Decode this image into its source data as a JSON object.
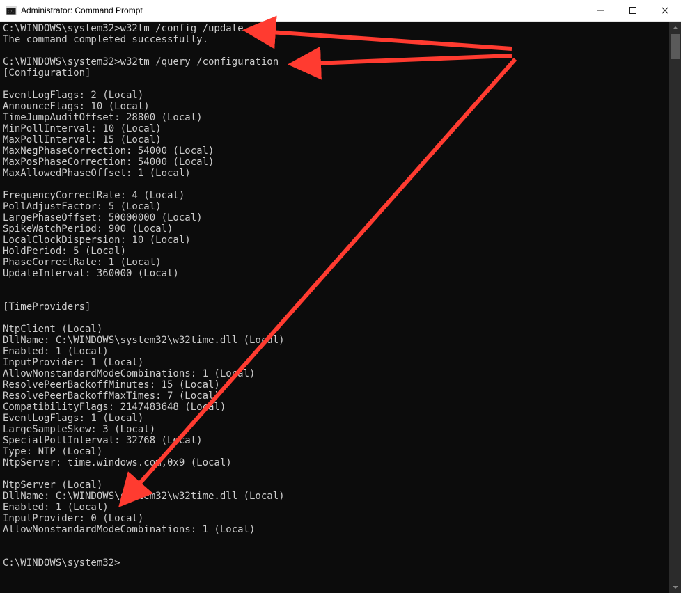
{
  "window": {
    "title": "Administrator: Command Prompt"
  },
  "terminal": {
    "prompt": "C:\\WINDOWS\\system32>",
    "cmd1": "w32tm /config /update",
    "cmd1_out": "The command completed successfully.",
    "cmd2": "w32tm /query /configuration",
    "configHeader": "[Configuration]",
    "config": [
      "EventLogFlags: 2 (Local)",
      "AnnounceFlags: 10 (Local)",
      "TimeJumpAuditOffset: 28800 (Local)",
      "MinPollInterval: 10 (Local)",
      "MaxPollInterval: 15 (Local)",
      "MaxNegPhaseCorrection: 54000 (Local)",
      "MaxPosPhaseCorrection: 54000 (Local)",
      "MaxAllowedPhaseOffset: 1 (Local)"
    ],
    "config2": [
      "FrequencyCorrectRate: 4 (Local)",
      "PollAdjustFactor: 5 (Local)",
      "LargePhaseOffset: 50000000 (Local)",
      "SpikeWatchPeriod: 900 (Local)",
      "LocalClockDispersion: 10 (Local)",
      "HoldPeriod: 5 (Local)",
      "PhaseCorrectRate: 1 (Local)",
      "UpdateInterval: 360000 (Local)"
    ],
    "providersHeader": "[TimeProviders]",
    "ntpClient": [
      "NtpClient (Local)",
      "DllName: C:\\WINDOWS\\system32\\w32time.dll (Local)",
      "Enabled: 1 (Local)",
      "InputProvider: 1 (Local)",
      "AllowNonstandardModeCombinations: 1 (Local)",
      "ResolvePeerBackoffMinutes: 15 (Local)",
      "ResolvePeerBackoffMaxTimes: 7 (Local)",
      "CompatibilityFlags: 2147483648 (Local)",
      "EventLogFlags: 1 (Local)",
      "LargeSampleSkew: 3 (Local)",
      "SpecialPollInterval: 32768 (Local)",
      "Type: NTP (Local)",
      "NtpServer: time.windows.com,0x9 (Local)"
    ],
    "ntpServer": [
      "NtpServer (Local)",
      "DllName: C:\\WINDOWS\\system32\\w32time.dll (Local)",
      "Enabled: 1 (Local)",
      "InputProvider: 0 (Local)",
      "AllowNonstandardModeCombinations: 1 (Local)"
    ]
  },
  "annotations": {
    "color": "#ff3b30"
  }
}
